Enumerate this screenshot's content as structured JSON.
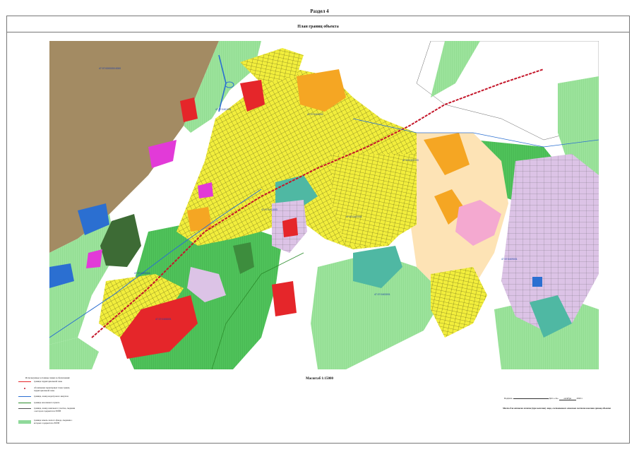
{
  "section": {
    "title": "Раздел 4"
  },
  "plan": {
    "title": "План границ объекта"
  },
  "map": {
    "scale_label": "Масштаб 1:15000",
    "colors": {
      "residential": "#f2ee3c",
      "green": "#4fc25a",
      "light_green": "#9be39b",
      "forest": "#3d6b35",
      "brown": "#a38b63",
      "orange": "#f5a623",
      "red": "#e5262a",
      "magenta": "#e23ad8",
      "pink": "#f4a9d0",
      "lilac": "#dcc3e6",
      "teal": "#4fb8a3",
      "blue": "#2b6fd1",
      "peach": "#fde3b5"
    },
    "parcel_labels": [
      "47:07:0000000:0000",
      "47:07:0401001",
      "47:07:0404001",
      "47:07:0402003",
      "47:07:0402001",
      "47:07:0401003",
      "47:07:0405004",
      "47:07:0406001",
      "47:07:0403001",
      "47:07:0409001"
    ]
  },
  "legend": {
    "title": "Используемые условные знаки и обозначения:",
    "items": [
      {
        "label": "граница территориальной зоны",
        "color": "#e5262a"
      },
      {
        "label": "обозначение характерных точек границ территориальной зоны",
        "color": "#c4162a"
      },
      {
        "label": "граница, номер кадастрового квартала",
        "color": "#2b6fd1"
      },
      {
        "label": "граница населенного пункта",
        "color": "#2c8c2c"
      },
      {
        "label": "граница, номер земельного участка, сведения о котором содержатся в ЕГРН",
        "color": "#555555"
      },
      {
        "label": "граница земель лесного фонда, сведения о которых содержатся в ЕГРН",
        "color": "#8fd99a"
      }
    ]
  },
  "signature": {
    "prefix": "Подпись",
    "date_prefix": "Дата «",
    "day": "14",
    "month": "октября",
    "year": "2020",
    "suffix": "г."
  },
  "note": "Место для оттиска печати (при наличии) лица, составившего описание местоположения границ объекта"
}
